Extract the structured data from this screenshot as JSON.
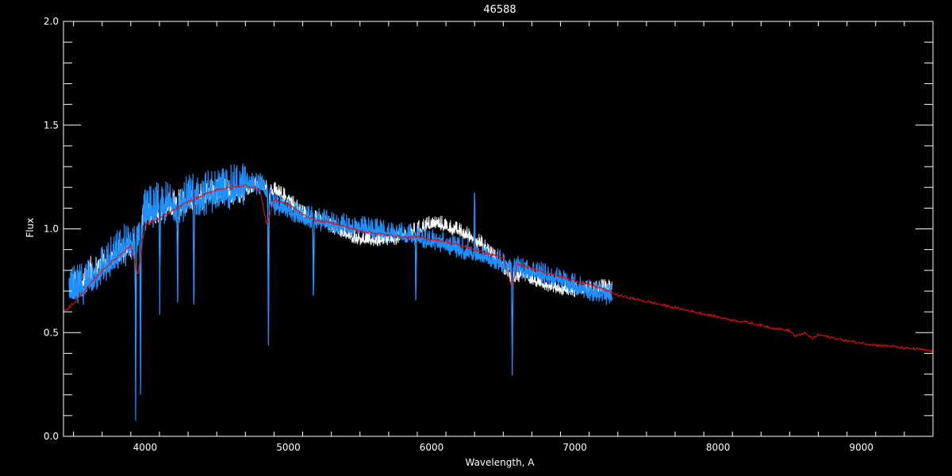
{
  "chart_data": {
    "type": "line",
    "title": "46588",
    "xlabel": "Wavelength, A",
    "ylabel": "Flux",
    "xlim": [
      3430,
      9500
    ],
    "ylim": [
      0,
      2.0
    ],
    "xticks": [
      {
        "value": 4000,
        "label": "4000"
      },
      {
        "value": 5000,
        "label": "5000"
      },
      {
        "value": 6000,
        "label": "6000"
      },
      {
        "value": 7000,
        "label": "7000"
      },
      {
        "value": 8000,
        "label": "8000"
      },
      {
        "value": 9000,
        "label": "9000"
      }
    ],
    "yticks": [
      {
        "value": 0.0,
        "label": "0.0"
      },
      {
        "value": 0.5,
        "label": "0.5"
      },
      {
        "value": 1.0,
        "label": "1.0"
      },
      {
        "value": 1.5,
        "label": "1.5"
      },
      {
        "value": 2.0,
        "label": "2.0"
      }
    ],
    "grid": false,
    "background": "#000000",
    "axis_color": "#ffffff",
    "series": [
      {
        "color": "#ffffff",
        "style": "noisy",
        "x": [
          3470,
          3550,
          3650,
          3750,
          3850,
          3950,
          4000,
          4100,
          4200,
          4300,
          4400,
          4500,
          4600,
          4700,
          4800,
          4850,
          4900,
          5000,
          5100,
          5200,
          5300,
          5400,
          5500,
          5600,
          5700,
          5800,
          5900,
          5950,
          6000,
          6050,
          6100,
          6200,
          6300,
          6400,
          6500,
          6550,
          6600,
          6650,
          6700,
          6800,
          6900,
          7000,
          7100,
          7200,
          7260
        ],
        "y": [
          0.72,
          0.75,
          0.82,
          0.85,
          0.9,
          0.95,
          1.08,
          1.1,
          1.12,
          1.14,
          1.16,
          1.18,
          1.18,
          1.2,
          1.22,
          1.2,
          1.19,
          1.15,
          1.08,
          1.05,
          1.02,
          0.98,
          0.96,
          0.95,
          0.95,
          0.97,
          1.0,
          1.02,
          1.03,
          1.03,
          1.02,
          0.99,
          0.96,
          0.9,
          0.82,
          0.78,
          0.78,
          0.79,
          0.76,
          0.74,
          0.72,
          0.71,
          0.71,
          0.72,
          0.72
        ]
      },
      {
        "color": "#1e90ff",
        "style": "noisy",
        "x": [
          3470,
          3550,
          3650,
          3750,
          3850,
          3950,
          4000,
          4100,
          4200,
          4300,
          4400,
          4500,
          4600,
          4700,
          4800,
          4850,
          4900,
          5000,
          5100,
          5200,
          5300,
          5400,
          5500,
          5600,
          5700,
          5800,
          5900,
          5950,
          6000,
          6050,
          6100,
          6200,
          6300,
          6400,
          6500,
          6550,
          6600,
          6650,
          6700,
          6800,
          6900,
          7000,
          7100,
          7200,
          7260
        ],
        "y": [
          0.7,
          0.73,
          0.8,
          0.85,
          0.92,
          0.96,
          1.1,
          1.12,
          1.13,
          1.15,
          1.17,
          1.19,
          1.2,
          1.22,
          1.22,
          1.18,
          1.12,
          1.1,
          1.06,
          1.05,
          1.03,
          1.02,
          1.01,
          1.0,
          0.99,
          0.98,
          0.97,
          0.96,
          0.95,
          0.94,
          0.93,
          0.91,
          0.89,
          0.87,
          0.84,
          0.83,
          0.82,
          0.81,
          0.8,
          0.78,
          0.76,
          0.73,
          0.71,
          0.69,
          0.68
        ]
      },
      {
        "color": "#e01010",
        "style": "line",
        "x": [
          3430,
          3500,
          3600,
          3700,
          3800,
          3900,
          3950,
          4000,
          4100,
          4200,
          4300,
          4400,
          4500,
          4600,
          4700,
          4800,
          4850,
          4900,
          5000,
          5100,
          5200,
          5300,
          5400,
          5500,
          5600,
          5700,
          5800,
          5900,
          6000,
          6100,
          6200,
          6300,
          6400,
          6500,
          6560,
          6600,
          6700,
          6800,
          6900,
          7000,
          7100,
          7200,
          7300,
          7400,
          7500,
          7600,
          7700,
          7800,
          7900,
          8000,
          8100,
          8200,
          8300,
          8400,
          8500,
          8540,
          8600,
          8660,
          8700,
          8800,
          8900,
          9000,
          9100,
          9200,
          9300,
          9400,
          9500
        ],
        "y": [
          0.6,
          0.64,
          0.72,
          0.8,
          0.86,
          0.92,
          0.78,
          1.02,
          1.05,
          1.09,
          1.13,
          1.16,
          1.19,
          1.2,
          1.21,
          1.19,
          1.02,
          1.14,
          1.12,
          1.07,
          1.04,
          1.03,
          1.01,
          0.99,
          0.98,
          0.97,
          0.96,
          0.96,
          0.95,
          0.94,
          0.92,
          0.9,
          0.88,
          0.86,
          0.72,
          0.83,
          0.81,
          0.79,
          0.77,
          0.75,
          0.73,
          0.71,
          0.68,
          0.665,
          0.65,
          0.635,
          0.62,
          0.605,
          0.59,
          0.575,
          0.56,
          0.55,
          0.535,
          0.52,
          0.51,
          0.48,
          0.5,
          0.47,
          0.49,
          0.475,
          0.46,
          0.45,
          0.44,
          0.435,
          0.425,
          0.42,
          0.41
        ]
      },
      {
        "color": "#1e90ff",
        "style": "line",
        "x": [
          3470,
          7260
        ],
        "y": [
          0.0,
          0.0
        ]
      }
    ],
    "absorption_lines": [
      {
        "x": 3934,
        "depth": 0.78
      },
      {
        "x": 3968,
        "depth": 0.8
      },
      {
        "x": 4102,
        "depth": 0.5
      },
      {
        "x": 4227,
        "depth": 0.45
      },
      {
        "x": 4340,
        "depth": 0.62
      },
      {
        "x": 4861,
        "depth": 0.8
      },
      {
        "x": 5175,
        "depth": 0.42
      },
      {
        "x": 5890,
        "depth": 0.3
      },
      {
        "x": 6563,
        "depth": 0.55
      }
    ],
    "emission_lines": [
      {
        "x": 6300,
        "peak": 1.18
      }
    ]
  }
}
